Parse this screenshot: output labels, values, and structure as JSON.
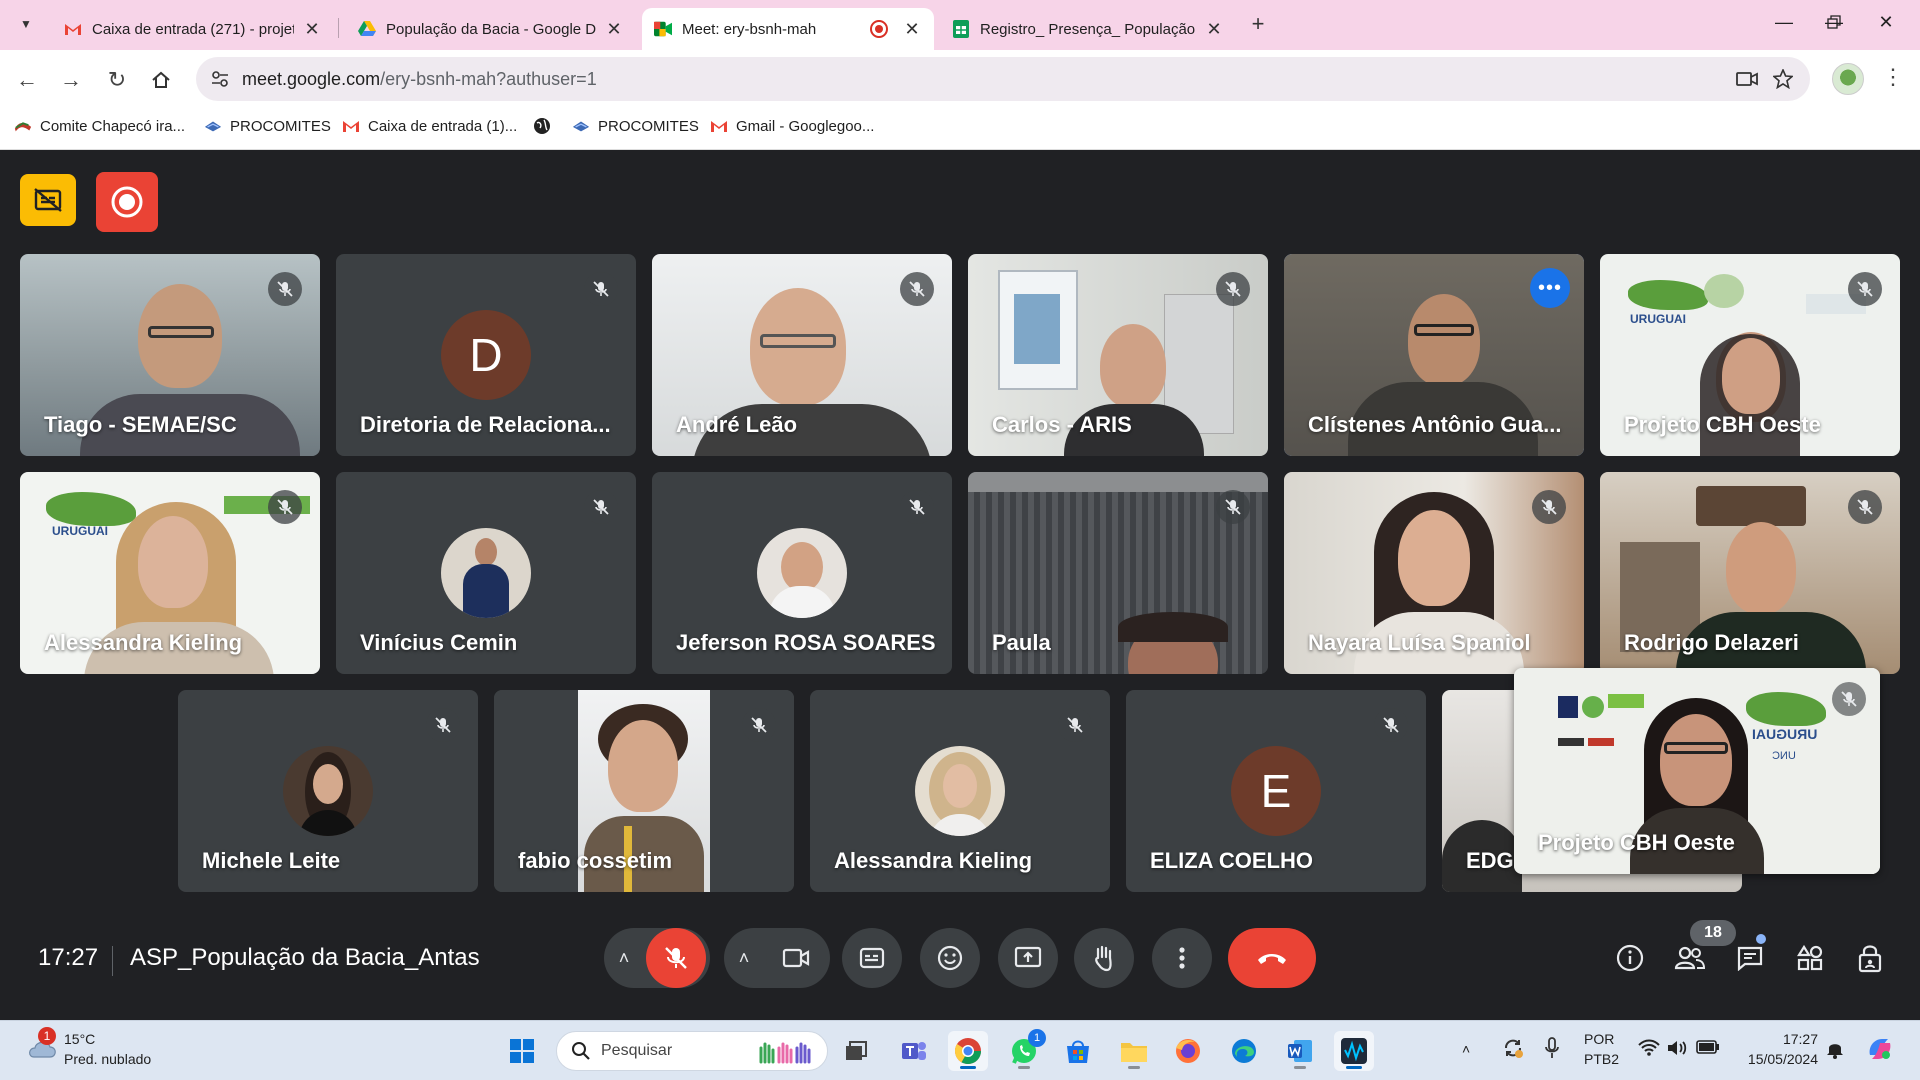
{
  "browser": {
    "tabs": [
      {
        "title": "Caixa de entrada (271) - projeto",
        "icon": "gmail-icon"
      },
      {
        "title": "População da Bacia - Google Drive",
        "icon": "google-drive-icon"
      },
      {
        "title": "Meet: ery-bsnh-mah",
        "icon": "google-meet-icon",
        "active": true,
        "recording": true
      },
      {
        "title": "Registro_ Presença_ População",
        "icon": "google-sheets-icon"
      }
    ],
    "url_host": "meet.google.com",
    "url_path": "/ery-bsnh-mah?authuser=1",
    "bookmarks": [
      {
        "label": "Comite Chapecó ira...",
        "icon": "bookmark-site-icon"
      },
      {
        "label": "PROCOMITES",
        "icon": "procomites-icon"
      },
      {
        "label": "Caixa de entrada (1)...",
        "icon": "gmail-icon"
      },
      {
        "label": "",
        "icon": "globe-icon"
      },
      {
        "label": "PROCOMITES",
        "icon": "procomites-icon"
      },
      {
        "label": "Gmail - Googlegoo...",
        "icon": "gmail-icon"
      }
    ]
  },
  "meet": {
    "participants": [
      {
        "name": "Tiago - SEMAE/SC",
        "type": "video",
        "muted": true
      },
      {
        "name": "Diretoria de Relaciona...",
        "type": "letter",
        "letter": "D",
        "muted": true
      },
      {
        "name": "André Leão",
        "type": "video",
        "muted": true
      },
      {
        "name": "Carlos - ARIS",
        "type": "video",
        "muted": true
      },
      {
        "name": "Clístenes Antônio Gua...",
        "type": "video",
        "muted": false,
        "speaking": true
      },
      {
        "name": "Projeto CBH Oeste",
        "type": "video",
        "muted": true
      },
      {
        "name": "Alessandra Kieling",
        "type": "video",
        "muted": true
      },
      {
        "name": "Vinícius Cemin",
        "type": "photo",
        "muted": true
      },
      {
        "name": "Jeferson ROSA SOARES",
        "type": "photo",
        "muted": true
      },
      {
        "name": "Paula",
        "type": "video",
        "muted": true
      },
      {
        "name": "Nayara Luísa Spaniol",
        "type": "video",
        "muted": true
      },
      {
        "name": "Rodrigo Delazeri",
        "type": "video",
        "muted": true
      },
      {
        "name": "Michele Leite",
        "type": "photo",
        "muted": true
      },
      {
        "name": "fabio cossetim",
        "type": "video",
        "muted": true
      },
      {
        "name": "Alessandra Kieling",
        "type": "photo",
        "muted": true
      },
      {
        "name": "ELIZA COELHO",
        "type": "letter",
        "letter": "E",
        "muted": true
      },
      {
        "name": "EDG",
        "type": "video",
        "muted": true
      }
    ],
    "self_view": {
      "name": "Projeto CBH Oeste",
      "muted": true
    },
    "overlay_banner_text": "URUGUAI",
    "overlay_logo_text": "UNC",
    "time": "17:27",
    "meeting_title": "ASP_População da Bacia_Antas",
    "participant_count": "18"
  },
  "taskbar": {
    "weather_badge": "1",
    "temperature": "15°C",
    "weather_desc": "Pred. nublado",
    "search_label": "Pesquisar",
    "whatsapp_badge": "1",
    "lang_line1": "POR",
    "lang_line2": "PTB2",
    "time": "17:27",
    "date": "15/05/2024"
  },
  "colors": {
    "meet_bg": "#202124",
    "tile_bg": "#3c4043",
    "hangup_red": "#ea4335",
    "speaking_blue": "#8ab4f8",
    "tabbar_pink": "#f7d4e8"
  }
}
